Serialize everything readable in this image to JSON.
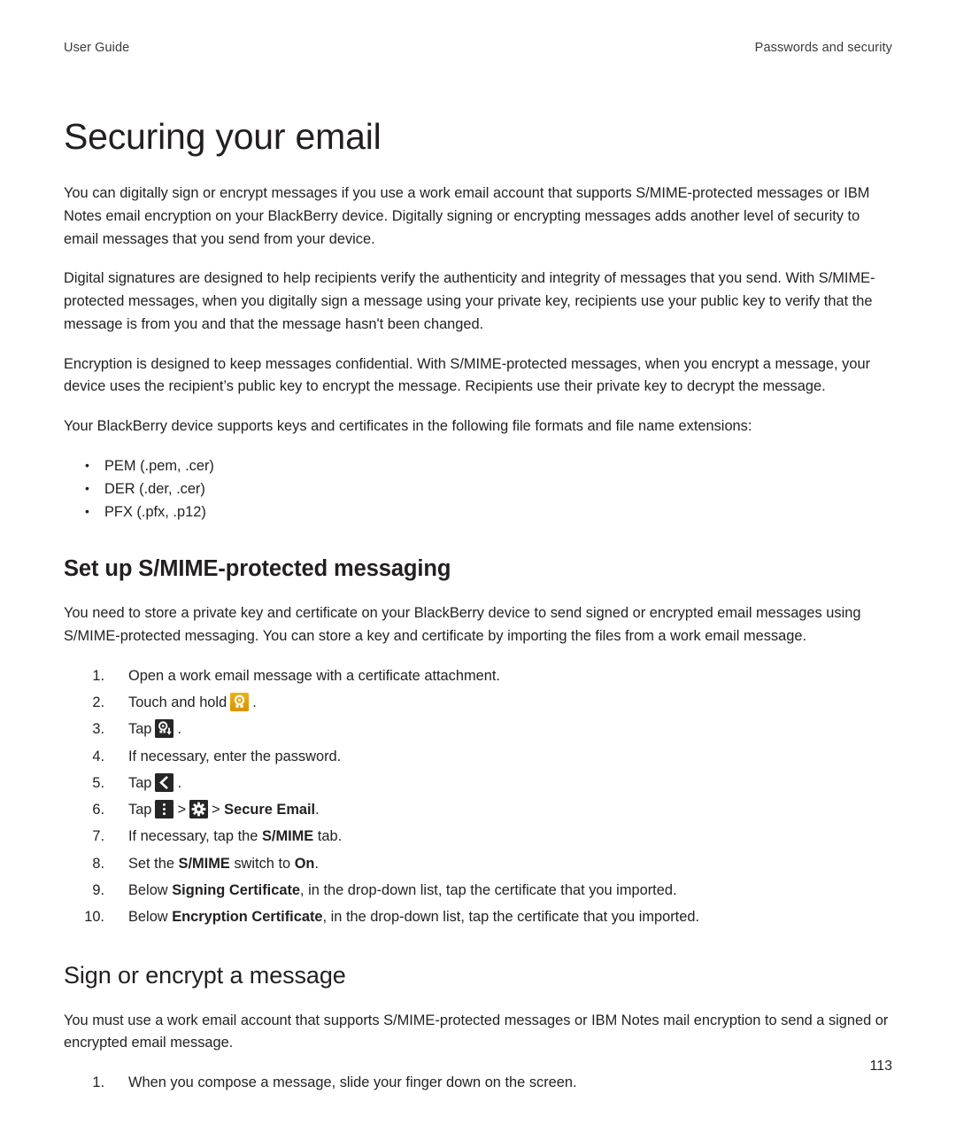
{
  "header": {
    "left": "User Guide",
    "right": "Passwords and security"
  },
  "title": "Securing your email",
  "intro_paragraphs": [
    "You can digitally sign or encrypt messages if you use a work email account that supports S/MIME-protected messages or IBM Notes email encryption on your BlackBerry device. Digitally signing or encrypting messages adds another level of security to email messages that you send from your device.",
    "Digital signatures are designed to help recipients verify the authenticity and integrity of messages that you send. With S/MIME-protected messages, when you digitally sign a message using your private key, recipients use your public key to verify that the message is from you and that the message hasn't been changed.",
    "Encryption is designed to keep messages confidential. With S/MIME-protected messages, when you encrypt a message, your device uses the recipient’s public key to encrypt the message. Recipients use their private key to decrypt the message.",
    "Your BlackBerry device supports keys and certificates in the following file formats and file name extensions:"
  ],
  "file_formats": [
    "PEM (.pem, .cer)",
    "DER (.der, .cer)",
    "PFX (.pfx, .p12)"
  ],
  "section_setup": {
    "heading": "Set up S/MIME-protected messaging",
    "intro": "You need to store a private key and certificate on your BlackBerry device to send signed or encrypted email messages using S/MIME-protected messaging. You can store a key and certificate by importing the files from a work email message.",
    "steps": [
      {
        "num": "1.",
        "text": "Open a work email message with a certificate attachment."
      },
      {
        "num": "2.",
        "pre": "Touch and hold",
        "icon": "certificate-badge-icon",
        "post": "."
      },
      {
        "num": "3.",
        "pre": "Tap",
        "icon": "certificate-download-icon",
        "post": "."
      },
      {
        "num": "4.",
        "text": "If necessary, enter the password."
      },
      {
        "num": "5.",
        "pre": "Tap",
        "icon": "back-chevron-icon",
        "post": "."
      },
      {
        "num": "6.",
        "pre": "Tap",
        "icon": "overflow-menu-icon",
        "mid": ">",
        "icon2": "settings-gear-icon",
        "mid2": ">",
        "bold": "Secure Email",
        "post": "."
      },
      {
        "num": "7.",
        "pre": "If necessary, tap the",
        "bold": "S/MIME",
        "post": "tab."
      },
      {
        "num": "8.",
        "pre": "Set the",
        "bold": "S/MIME",
        "mid": "switch to",
        "bold2": "On",
        "post": "."
      },
      {
        "num": "9.",
        "pre": "Below",
        "bold": "Signing Certificate",
        "post": ", in the drop-down list, tap the certificate that you imported."
      },
      {
        "num": "10.",
        "pre": "Below",
        "bold": "Encryption Certificate",
        "post": ", in the drop-down list, tap the certificate that you imported."
      }
    ]
  },
  "section_sign": {
    "heading": "Sign or encrypt a message",
    "intro": "You must use a work email account that supports S/MIME-protected messages or IBM Notes mail encryption to send a signed or encrypted email message.",
    "steps": [
      {
        "num": "1.",
        "text": "When you compose a message, slide your finger down on the screen."
      }
    ]
  },
  "folio": "113",
  "colors": {
    "text": "#231f20",
    "icon_gold": "#e2a008",
    "icon_dark": "#262626"
  }
}
